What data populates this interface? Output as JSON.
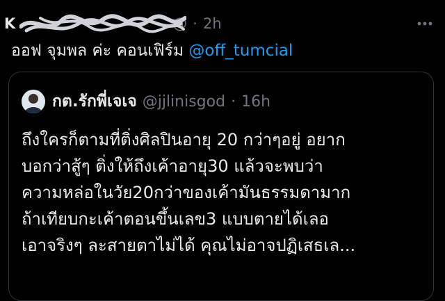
{
  "tweet": {
    "author_name": "K",
    "handle": "@",
    "separator": "·",
    "time": "2h",
    "text": "ออฟ จุมพล ค่ะ คอนเฟิร์ม",
    "mention": "@off_tumcial",
    "more_icon": "more-horizontal-icon"
  },
  "quote": {
    "author_name": "กต.รักพี่เจเจ",
    "handle": "@jjlinisgod",
    "separator": "·",
    "time": "16h",
    "lines": [
      "ถึงใครก็ตามที่ติ่งศิลปินอายุ 20 กว่าๆอยู่ อยาก",
      "บอกว่าสู้ๆ ติ่งให้ถึงเค้าอายุ30 แล้วจะพบว่า",
      "ความหล่อในวัย20กว่าของเค้ามันธรรมดามาก",
      "ถ้าเทียบกะเค้าตอนขึ้นเลข3 แบบตายได้เลอ",
      "เอาจริงๆ ละสายตาไม่ได้ คุณไม่อาจปฏิเสธเล..."
    ]
  },
  "colors": {
    "background": "#000000",
    "text": "#e7e9ea",
    "muted": "#71767b",
    "link": "#1d9bf0",
    "border": "#2f3336"
  }
}
